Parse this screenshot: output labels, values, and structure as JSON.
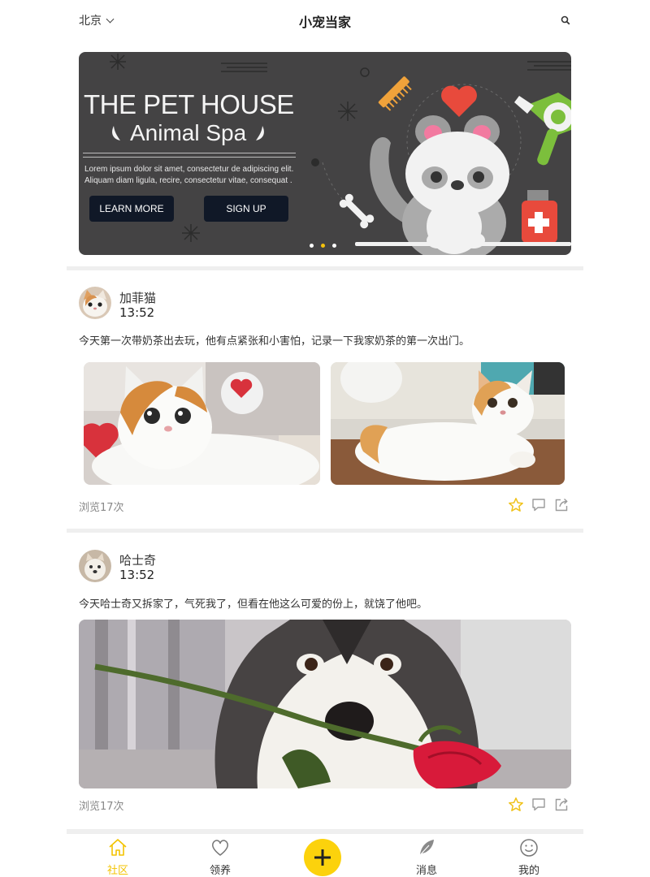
{
  "header": {
    "city": "北京",
    "title": "小宠当家"
  },
  "banner": {
    "title": "THE PET HOUSE",
    "subtitle": "Animal Spa",
    "lorem": "Lorem ipsum dolor sit amet, consectetur de adipiscing elit. Aliquam diam ligula, recire, consectetur vitae, consequat .",
    "learn_more": "LEARN MORE",
    "sign_up": "SIGN UP",
    "slides": 3,
    "active_slide": 2
  },
  "posts": [
    {
      "user": "加菲猫",
      "time": "13:52",
      "text": "今天第一次带奶茶出去玩，他有点紧张和小害怕，记录一下我家奶茶的第一次出门。",
      "views": "浏览17次"
    },
    {
      "user": "哈士奇",
      "time": "13:52",
      "text": "今天哈士奇又拆家了，气死我了，但看在他这么可爱的份上，就饶了他吧。",
      "views": "浏览17次"
    }
  ],
  "tabs": [
    {
      "label": "社区",
      "icon": "home-icon",
      "active": true
    },
    {
      "label": "领养",
      "icon": "heart-icon",
      "active": false
    },
    {
      "label": "",
      "icon": "plus-icon",
      "active": false
    },
    {
      "label": "消息",
      "icon": "feather-icon",
      "active": false
    },
    {
      "label": "我的",
      "icon": "smile-icon",
      "active": false
    }
  ],
  "colors": {
    "accent": "#fcd20c",
    "active_tab": "#f3c300",
    "banner_bg": "#444344"
  }
}
